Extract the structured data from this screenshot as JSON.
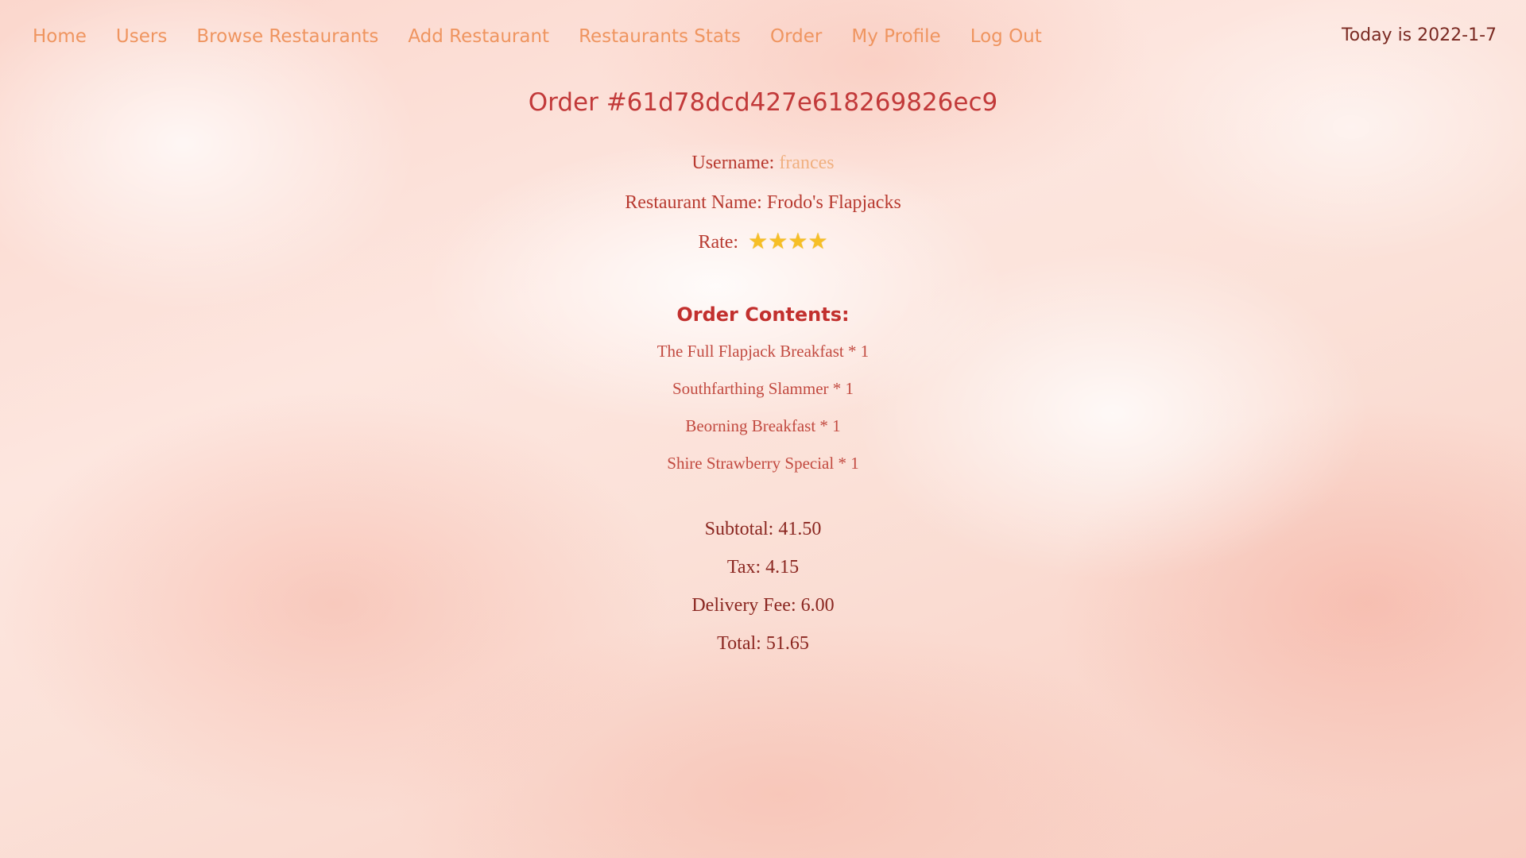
{
  "nav": {
    "links": [
      "Home",
      "Users",
      "Browse Restaurants",
      "Add Restaurant",
      "Restaurants Stats",
      "Order",
      "My Profile",
      "Log Out"
    ],
    "today": "Today is 2022-1-7"
  },
  "order": {
    "title": "Order #61d78dcd427e618269826ec9",
    "username_label": "Username: ",
    "username": "frances",
    "restaurant_label": "Restaurant Name: ",
    "restaurant": "Frodo's Flapjacks",
    "rate_label": "Rate: ",
    "rating": 4,
    "rating_max": 4,
    "star_glyph": "★",
    "contents_title": "Order Contents:",
    "items": [
      "The Full Flapjack Breakfast * 1",
      "Southfarthing Slammer * 1",
      "Beorning Breakfast * 1",
      "Shire Strawberry Special * 1"
    ],
    "subtotal": "Subtotal: 41.50",
    "tax": "Tax: 4.15",
    "delivery_fee": "Delivery Fee: 6.00",
    "total": "Total: 51.65"
  },
  "colors": {
    "nav_link": "#ef9560",
    "title": "#c23a3a",
    "star": "#f6bf26",
    "username": "#f0b080"
  }
}
